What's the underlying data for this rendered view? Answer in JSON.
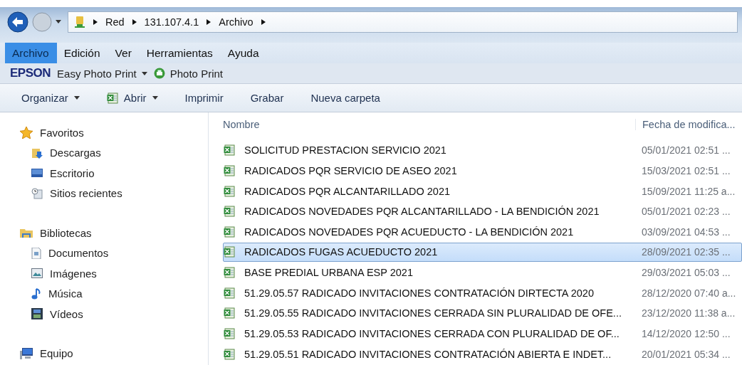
{
  "address": {
    "segments": [
      "Red",
      "131.107.4.1",
      "Archivo"
    ]
  },
  "menu": [
    {
      "label": "Archivo",
      "selected": true
    },
    {
      "label": "Edición",
      "selected": false
    },
    {
      "label": "Ver",
      "selected": false
    },
    {
      "label": "Herramientas",
      "selected": false
    },
    {
      "label": "Ayuda",
      "selected": false
    }
  ],
  "epson_bar": {
    "brand": "EPSON",
    "items": [
      {
        "label": "Easy Photo Print",
        "kind": "dropdown"
      },
      {
        "label": "Photo Print",
        "kind": "printer"
      }
    ]
  },
  "toolbar": [
    {
      "label": "Organizar",
      "kind": "menu"
    },
    {
      "label": "Abrir",
      "kind": "open-with"
    },
    {
      "label": "Imprimir",
      "kind": "command"
    },
    {
      "label": "Grabar",
      "kind": "command"
    },
    {
      "label": "Nueva carpeta",
      "kind": "command"
    }
  ],
  "sidebar": [
    {
      "label": "Favoritos",
      "kind": "favorites",
      "items": [
        {
          "label": "Descargas",
          "kind": "downloads"
        },
        {
          "label": "Escritorio",
          "kind": "desktop"
        },
        {
          "label": "Sitios recientes",
          "kind": "recent"
        }
      ]
    },
    {
      "label": "Bibliotecas",
      "kind": "libraries",
      "items": [
        {
          "label": "Documentos",
          "kind": "documents"
        },
        {
          "label": "Imágenes",
          "kind": "pictures"
        },
        {
          "label": "Música",
          "kind": "music"
        },
        {
          "label": "Vídeos",
          "kind": "videos"
        }
      ]
    },
    {
      "label": "Equipo",
      "kind": "computer"
    }
  ],
  "file_list": {
    "columns": [
      "Nombre",
      "Fecha de modifica..."
    ],
    "rows": [
      {
        "name": "SOLICITUD PRESTACION SERVICIO 2021",
        "modified": "05/01/2021 02:51 ...",
        "selected": false
      },
      {
        "name": "RADICADOS PQR SERVICIO DE ASEO 2021",
        "modified": "15/03/2021 02:51 ...",
        "selected": false
      },
      {
        "name": "RADICADOS PQR ALCANTARILLADO 2021",
        "modified": "15/09/2021 11:25 a...",
        "selected": false
      },
      {
        "name": "RADICADOS NOVEDADES PQR ALCANTARILLADO - LA BENDICIÓN 2021",
        "modified": "05/01/2021 02:23 ...",
        "selected": false
      },
      {
        "name": "RADICADOS NOVEDADES PQR ACUEDUCTO - LA BENDICIÓN 2021",
        "modified": "03/09/2021 04:53 ...",
        "selected": false
      },
      {
        "name": "RADICADOS FUGAS ACUEDUCTO 2021",
        "modified": "28/09/2021 02:35 ...",
        "selected": true
      },
      {
        "name": "BASE PREDIAL URBANA ESP 2021",
        "modified": "29/03/2021 05:03 ...",
        "selected": false
      },
      {
        "name": "51.29.05.57 RADICADO INVITACIONES CONTRATACIÓN DIRTECTA 2020",
        "modified": "28/12/2020 07:40 a...",
        "selected": false
      },
      {
        "name": "51.29.05.55 RADICADO INVITACIONES CERRADA SIN PLURALIDAD DE OFE...",
        "modified": "23/12/2020 11:38 a...",
        "selected": false
      },
      {
        "name": "51.29.05.53 RADICADO INVITACIONES CERRADA CON PLURALIDAD DE OF...",
        "modified": "14/12/2020 12:50 ...",
        "selected": false
      },
      {
        "name": "51.29.05.51 RADICADO INVITACIONES CONTRATACIÓN ABIERTA E INDET...",
        "modified": "20/01/2021 05:34 ...",
        "selected": false
      }
    ]
  }
}
